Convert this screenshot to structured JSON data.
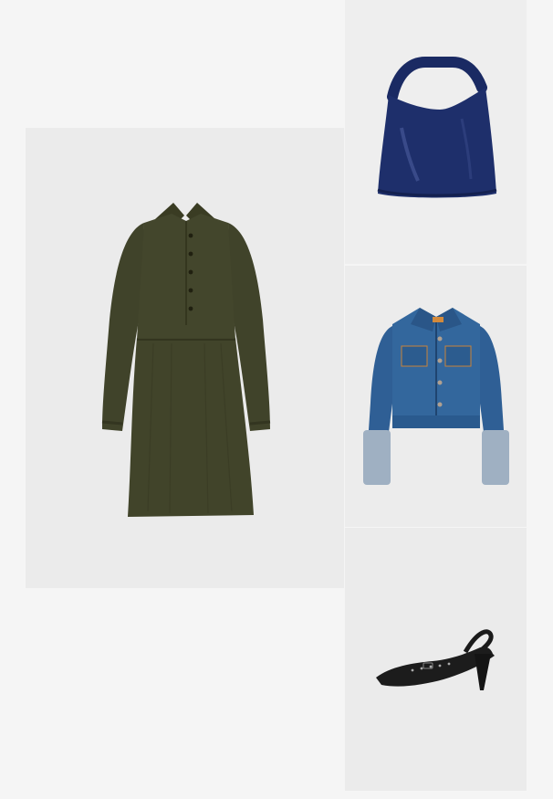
{
  "outfit": {
    "items": [
      {
        "id": "dress",
        "kind": "olive corduroy shirt dress",
        "color": "#3f4127"
      },
      {
        "id": "bag",
        "kind": "navy patent hobo bag",
        "color": "#1e2f6b"
      },
      {
        "id": "jacket",
        "kind": "cropped denim jacket",
        "color": "#2f5f95"
      },
      {
        "id": "shoe",
        "kind": "black slingback pump",
        "color": "#1a1a1a"
      }
    ]
  }
}
